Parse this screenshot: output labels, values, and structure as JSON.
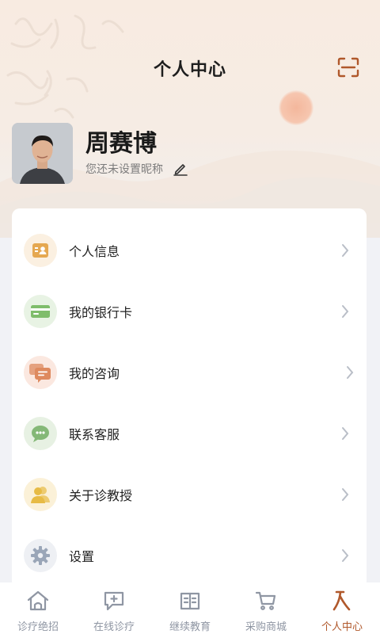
{
  "header": {
    "title": "个人中心",
    "scan_icon": "scan-icon"
  },
  "profile": {
    "name": "周赛博",
    "nickname_hint": "您还未设置昵称",
    "edit_icon": "pencil-icon"
  },
  "menu": [
    {
      "label": "个人信息",
      "icon": "id-card-icon",
      "bg": "#fbf0e1",
      "color": "#e5a851"
    },
    {
      "label": "我的银行卡",
      "icon": "bank-card-icon",
      "bg": "#e8f3e4",
      "color": "#7fbd6b"
    },
    {
      "label": "我的咨询",
      "icon": "chat-bubbles-icon",
      "bg": "#fbe8e0",
      "color": "#de8a5f"
    },
    {
      "label": "联系客服",
      "icon": "customer-service-icon",
      "bg": "#e7f1e3",
      "color": "#84b877"
    },
    {
      "label": "关于诊教授",
      "icon": "users-icon",
      "bg": "#fbf1d8",
      "color": "#e7bb45"
    },
    {
      "label": "设置",
      "icon": "gear-icon",
      "bg": "#eef0f4",
      "color": "#9aa6b8"
    }
  ],
  "tabbar": [
    {
      "label": "诊疗绝招",
      "icon": "house-icon",
      "active": false
    },
    {
      "label": "在线诊疗",
      "icon": "medical-chat-icon",
      "active": false
    },
    {
      "label": "继续教育",
      "icon": "book-icon",
      "active": false
    },
    {
      "label": "采购商城",
      "icon": "cart-icon",
      "active": false
    },
    {
      "label": "个人中心",
      "icon": "person-icon",
      "active": true
    }
  ],
  "colors": {
    "accent": "#b0582b",
    "inactive_tab": "#8f96a3"
  }
}
